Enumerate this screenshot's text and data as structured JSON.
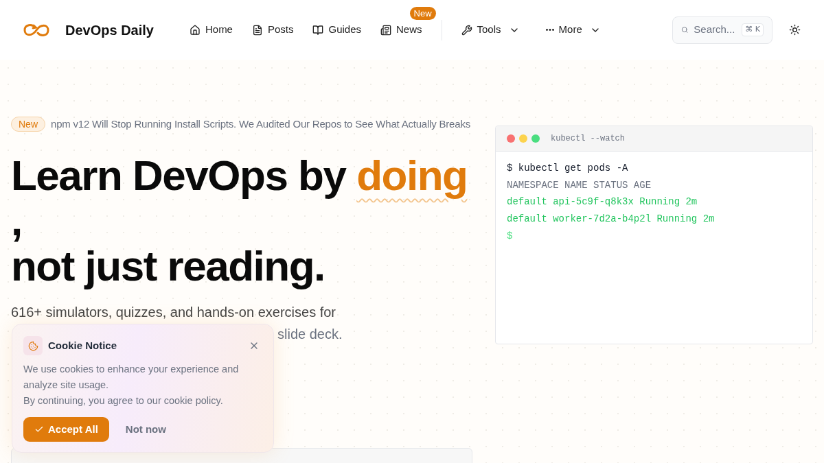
{
  "brand": {
    "name": "DevOps Daily"
  },
  "nav": [
    {
      "label": "Home",
      "kind": "link"
    },
    {
      "label": "Posts",
      "kind": "link"
    },
    {
      "label": "Guides",
      "kind": "link"
    },
    {
      "label": "News",
      "kind": "link",
      "badge": "New"
    },
    {
      "label": "Tools",
      "kind": "menu"
    },
    {
      "label": "More",
      "kind": "menu"
    }
  ],
  "search": {
    "placeholder": "Search...",
    "shortcut": "⌘ K"
  },
  "announcement": {
    "badge": "New",
    "text": "npm v12 Will Stop Running Install Scripts. We Audited Our Repos to See What Actually Breaks"
  },
  "hero": {
    "heading": "Learn DevOps by",
    "highlight": "doing",
    "comma": ",",
    "heading_end": "not just reading.",
    "lead_line_1": "616+ simulators, quizzes, and hands-on exercises for",
    "lead_line_2": "slide deck."
  },
  "terminal": {
    "title": "kubectl --watch",
    "lines": [
      {
        "text": "$ kubectl get pods -A",
        "kind": "command"
      },
      {
        "text": "NAMESPACE NAME STATUS AGE",
        "kind": "header"
      },
      {
        "text": "default api-5c9f-q8k3x Running 2m",
        "kind": "output"
      },
      {
        "text": "default worker-7d2a-b4p2l Running 2m",
        "kind": "output"
      },
      {
        "text": "$",
        "kind": "prompt"
      }
    ]
  },
  "cookie": {
    "title": "Cookie Notice",
    "body": [
      "We use cookies to enhance your experience and analyze site usage.",
      "By continuing, you agree to our cookie policy."
    ],
    "accept": "Accept All",
    "decline": "Not now"
  }
}
